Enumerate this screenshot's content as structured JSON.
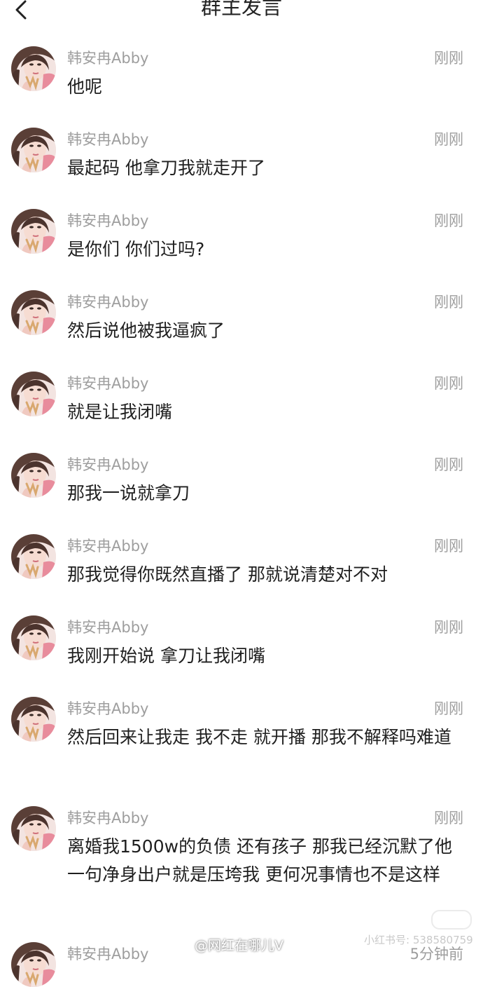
{
  "header": {
    "title": "群主发言",
    "back_icon": "chevron-left-icon"
  },
  "messages": [
    {
      "name": "韩安冉Abby",
      "time": "刚刚",
      "text": "他呢"
    },
    {
      "name": "韩安冉Abby",
      "time": "刚刚",
      "text": "最起码 他拿刀我就走开了"
    },
    {
      "name": "韩安冉Abby",
      "time": "刚刚",
      "text": "是你们 你们过吗?"
    },
    {
      "name": "韩安冉Abby",
      "time": "刚刚",
      "text": "然后说他被我逼疯了"
    },
    {
      "name": "韩安冉Abby",
      "time": "刚刚",
      "text": "就是让我闭嘴"
    },
    {
      "name": "韩安冉Abby",
      "time": "刚刚",
      "text": "那我一说就拿刀"
    },
    {
      "name": "韩安冉Abby",
      "time": "刚刚",
      "text": "那我觉得你既然直播了 那就说清楚对不对"
    },
    {
      "name": "韩安冉Abby",
      "time": "刚刚",
      "text": "我刚开始说 拿刀让我闭嘴"
    },
    {
      "name": "韩安冉Abby",
      "time": "刚刚",
      "text": "然后回来让我走 我不走 就开播 那我不解释吗难道"
    },
    {
      "name": "韩安冉Abby",
      "time": "刚刚",
      "text": "离婚我1500w的负债 还有孩子 那我已经沉默了他一句净身出户就是压垮我 更何况事情也不是这样"
    },
    {
      "name": "韩安冉Abby",
      "time": "5分钟前",
      "text": ""
    }
  ],
  "watermarks": {
    "weibo": "@网红在哪儿V",
    "xhs": "小红书号: 538580759"
  }
}
